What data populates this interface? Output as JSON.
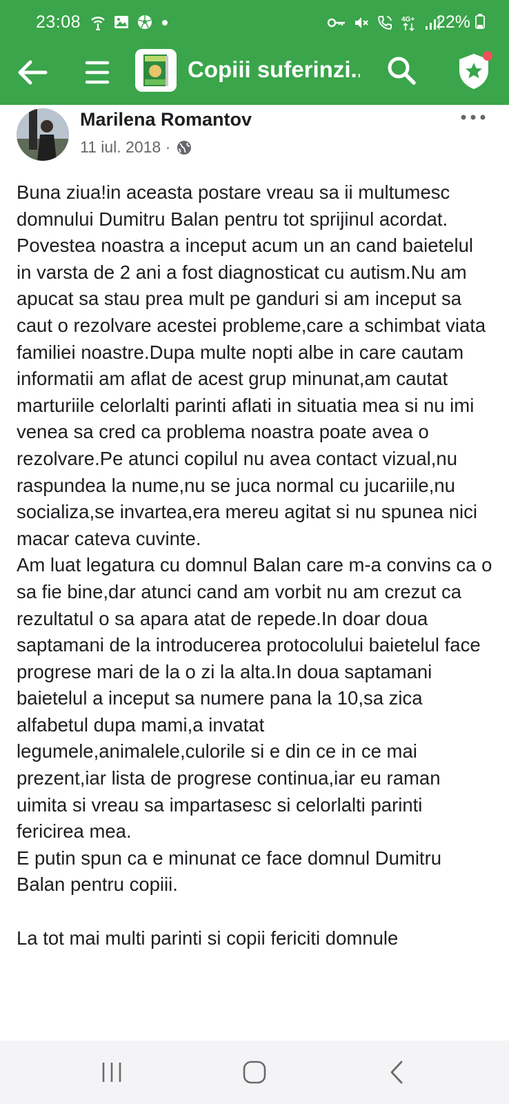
{
  "status_bar": {
    "time": "23:08",
    "battery": "22%",
    "left_icons": [
      "wifi-hotspot-icon",
      "image-icon",
      "soccer-ball-icon",
      "dot-icon"
    ],
    "right_icons": [
      "key-icon",
      "mute-icon",
      "wifi-call-icon",
      "4g-icon",
      "signal-icon",
      "battery-icon"
    ]
  },
  "app_bar": {
    "title": "Copiii suferinzi...",
    "accent_color": "#3aa54a"
  },
  "post": {
    "author": "Marilena Romantov",
    "date": "11 iul. 2018 ·",
    "visibility_icon": "globe-icon",
    "paragraphs": [
      "Buna ziua!in aceasta postare vreau sa ii multumesc domnului Dumitru Balan pentru tot sprijinul acordat.",
      "Povestea noastra a inceput acum un an cand baietelul in varsta de 2 ani a fost diagnosticat cu autism.Nu am apucat sa stau prea mult pe ganduri si am inceput sa caut o rezolvare acestei probleme,care a schimbat viata familiei noastre.Dupa multe nopti albe in care cautam informatii am aflat de acest grup minunat,am cautat marturiile celorlalti parinti aflati in situatia mea si nu imi venea sa cred ca problema noastra poate avea o rezolvare.Pe atunci copilul nu avea contact vizual,nu raspundea la nume,nu se juca normal cu jucariile,nu socializa,se invartea,era mereu agitat si nu spunea nici macar cateva cuvinte.",
      "Am luat legatura cu domnul Balan care m-a convins ca o sa fie bine,dar atunci cand am vorbit nu am crezut ca rezultatul o sa apara atat de repede.In doar doua saptamani de la introducerea protocolului baietelul face progrese mari de la o zi la alta.In doua saptamani baietelul a inceput sa numere pana la 10,sa zica alfabetul dupa mami,a invatat legumele,animalele,culorile si e din ce in ce mai prezent,iar lista de progrese continua,iar eu raman uimita si vreau sa impartasesc si celorlalti parinti fericirea mea.",
      "E putin spun ca e minunat ce face domnul Dumitru Balan pentru copiii.",
      "La tot mai multi parinti si copii fericiti domnule"
    ]
  }
}
